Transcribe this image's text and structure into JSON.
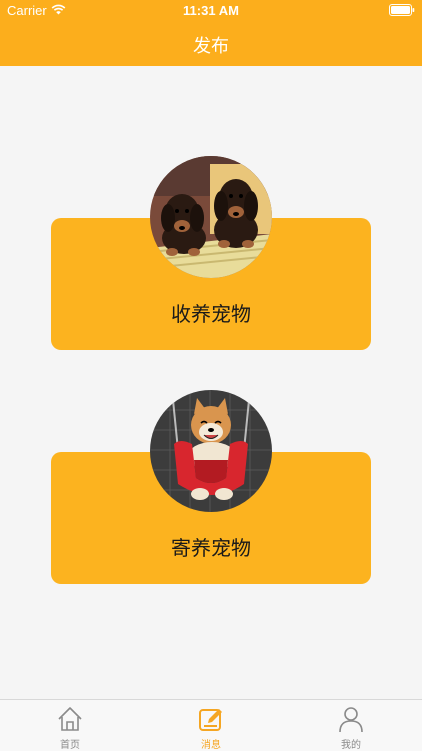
{
  "status_bar": {
    "carrier": "Carrier",
    "time": "11:31 AM"
  },
  "nav": {
    "title": "发布"
  },
  "options": [
    {
      "label": "收养宠物",
      "image": "dachshund-puppies-photo"
    },
    {
      "label": "寄养宠物",
      "image": "shiba-inu-swing-photo"
    }
  ],
  "tabbar": {
    "items": [
      {
        "label": "首页",
        "icon": "home-icon",
        "active": false
      },
      {
        "label": "消息",
        "icon": "edit-icon",
        "active": true
      },
      {
        "label": "我的",
        "icon": "user-icon",
        "active": false
      }
    ]
  },
  "colors": {
    "accent": "#FCAE1C",
    "card": "#FCB31F",
    "active_tab": "#F5A623",
    "inactive_tab": "#8a8a8a",
    "background": "#f5f5f5"
  }
}
